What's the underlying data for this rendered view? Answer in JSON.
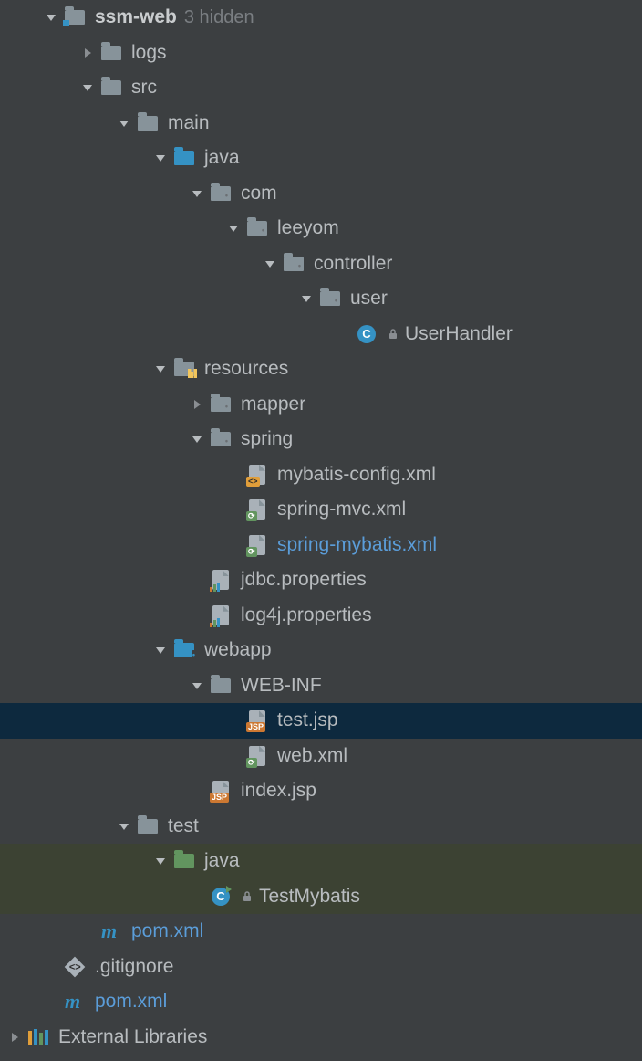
{
  "tree": [
    {
      "indent": 1,
      "arrow": "down",
      "icon": "folder-module",
      "label": "ssm-web",
      "bold": true,
      "hint": "3 hidden"
    },
    {
      "indent": 2,
      "arrow": "right",
      "icon": "folder",
      "label": "logs"
    },
    {
      "indent": 2,
      "arrow": "down",
      "icon": "folder",
      "label": "src"
    },
    {
      "indent": 3,
      "arrow": "down",
      "icon": "folder",
      "label": "main"
    },
    {
      "indent": 4,
      "arrow": "down",
      "icon": "folder-blue",
      "label": "java"
    },
    {
      "indent": 5,
      "arrow": "down",
      "icon": "folder-pkg",
      "label": "com"
    },
    {
      "indent": 6,
      "arrow": "down",
      "icon": "folder-pkg",
      "label": "leeyom"
    },
    {
      "indent": 7,
      "arrow": "down",
      "icon": "folder-pkg",
      "label": "controller"
    },
    {
      "indent": 8,
      "arrow": "down",
      "icon": "folder-pkg",
      "label": "user"
    },
    {
      "indent": 9,
      "arrow": "none",
      "icon": "class",
      "lock": true,
      "label": "UserHandler"
    },
    {
      "indent": 4,
      "arrow": "down",
      "icon": "folder-res",
      "label": "resources"
    },
    {
      "indent": 5,
      "arrow": "right",
      "icon": "folder-pkg",
      "label": "mapper"
    },
    {
      "indent": 5,
      "arrow": "down",
      "icon": "folder-pkg",
      "label": "spring"
    },
    {
      "indent": 6,
      "arrow": "none",
      "icon": "file-xml-code",
      "label": "mybatis-config.xml"
    },
    {
      "indent": 6,
      "arrow": "none",
      "icon": "file-spring",
      "label": "spring-mvc.xml"
    },
    {
      "indent": 6,
      "arrow": "none",
      "icon": "file-spring",
      "label": "spring-mybatis.xml",
      "link": true
    },
    {
      "indent": 5,
      "arrow": "none",
      "icon": "file-prop",
      "label": "jdbc.properties"
    },
    {
      "indent": 5,
      "arrow": "none",
      "icon": "file-prop",
      "label": "log4j.properties"
    },
    {
      "indent": 4,
      "arrow": "down",
      "icon": "folder-blue-web",
      "label": "webapp"
    },
    {
      "indent": 5,
      "arrow": "down",
      "icon": "folder",
      "label": "WEB-INF"
    },
    {
      "indent": 6,
      "arrow": "none",
      "icon": "file-jsp",
      "label": "test.jsp",
      "selected": true
    },
    {
      "indent": 6,
      "arrow": "none",
      "icon": "file-spring",
      "label": "web.xml"
    },
    {
      "indent": 5,
      "arrow": "none",
      "icon": "file-jsp",
      "label": "index.jsp"
    },
    {
      "indent": 3,
      "arrow": "down",
      "icon": "folder",
      "label": "test"
    },
    {
      "indent": 4,
      "arrow": "down",
      "icon": "folder-green",
      "label": "java",
      "hl": true
    },
    {
      "indent": 5,
      "arrow": "none",
      "icon": "class-run",
      "lock": true,
      "label": "TestMybatis",
      "hl": true
    },
    {
      "indent": 2,
      "arrow": "none",
      "icon": "maven",
      "label": "pom.xml",
      "link": true
    },
    {
      "indent": 1,
      "arrow": "none",
      "icon": "gitignore",
      "label": ".gitignore"
    },
    {
      "indent": 1,
      "arrow": "none",
      "icon": "maven",
      "label": "pom.xml",
      "link": true
    },
    {
      "indent": 0,
      "arrow": "right",
      "icon": "extlib",
      "label": "External Libraries"
    }
  ]
}
